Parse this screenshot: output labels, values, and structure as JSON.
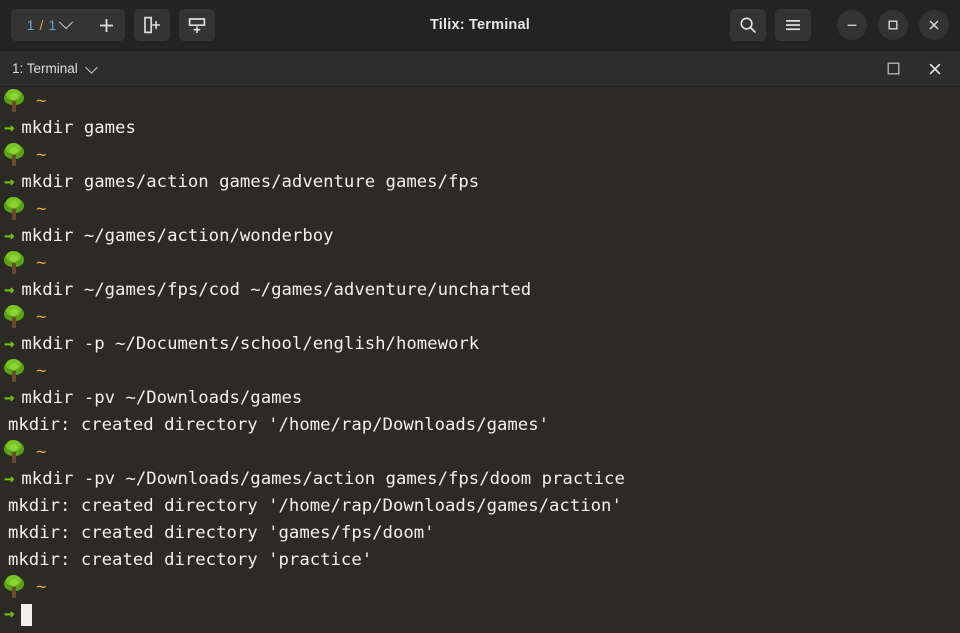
{
  "window": {
    "title": "Tilix: Terminal",
    "background_color": "#2b2a25",
    "header_color": "#232323"
  },
  "headerbar": {
    "session_selector": {
      "current": "1",
      "separator": "/",
      "total": "1",
      "name": "session-selector"
    },
    "new_session_label": "+",
    "split_right_label": "Add Terminal Right",
    "split_down_label": "Add Terminal Down",
    "search_label": "Find",
    "menu_label": "Session Menu",
    "minimize_label": "Minimize",
    "maximize_label": "Maximize",
    "close_label": "Close"
  },
  "tabbar": {
    "tab_title": "1: Terminal",
    "maximize_label": "Maximize Terminal",
    "close_label": "Close Terminal"
  },
  "terminal": {
    "prompt_symbol": "~",
    "arrow_symbol": "→",
    "tree_icon": "tree-emoji",
    "colors": {
      "text": "#f2f0e8",
      "path": "#e8a33d",
      "arrow": "#76c314",
      "background": "#2b2a25"
    },
    "lines": [
      {
        "type": "prompt",
        "path": "~"
      },
      {
        "type": "command",
        "text": "mkdir games"
      },
      {
        "type": "prompt",
        "path": "~"
      },
      {
        "type": "command",
        "text": "mkdir games/action games/adventure games/fps"
      },
      {
        "type": "prompt",
        "path": "~"
      },
      {
        "type": "command",
        "text": "mkdir ~/games/action/wonderboy"
      },
      {
        "type": "prompt",
        "path": "~"
      },
      {
        "type": "command",
        "text": "mkdir ~/games/fps/cod ~/games/adventure/uncharted"
      },
      {
        "type": "prompt",
        "path": "~"
      },
      {
        "type": "command",
        "text": "mkdir -p ~/Documents/school/english/homework"
      },
      {
        "type": "prompt",
        "path": "~"
      },
      {
        "type": "command",
        "text": "mkdir -pv ~/Downloads/games"
      },
      {
        "type": "output",
        "text": "mkdir: created directory '/home/rap/Downloads/games'"
      },
      {
        "type": "prompt",
        "path": "~"
      },
      {
        "type": "command",
        "text": "mkdir -pv ~/Downloads/games/action games/fps/doom practice"
      },
      {
        "type": "output",
        "text": "mkdir: created directory '/home/rap/Downloads/games/action'"
      },
      {
        "type": "output",
        "text": "mkdir: created directory 'games/fps/doom'"
      },
      {
        "type": "output",
        "text": "mkdir: created directory 'practice'"
      },
      {
        "type": "prompt",
        "path": "~"
      },
      {
        "type": "cursor",
        "text": ""
      }
    ]
  }
}
